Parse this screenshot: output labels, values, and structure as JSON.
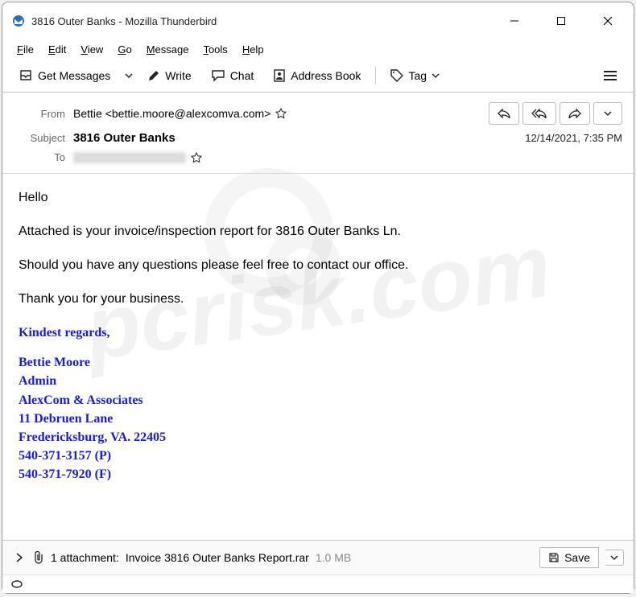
{
  "window": {
    "title": "3816 Outer Banks - Mozilla Thunderbird"
  },
  "menus": {
    "file": "File",
    "edit": "Edit",
    "view": "View",
    "go": "Go",
    "message": "Message",
    "tools": "Tools",
    "help": "Help"
  },
  "toolbar": {
    "get": "Get Messages",
    "write": "Write",
    "chat": "Chat",
    "address": "Address Book",
    "tag": "Tag"
  },
  "headers": {
    "from_label": "From",
    "from_value": "Bettie <bettie.moore@alexcomva.com>",
    "subject_label": "Subject",
    "subject_value": "3816 Outer Banks",
    "datetime": "12/14/2021, 7:35 PM",
    "to_label": "To"
  },
  "body": {
    "greeting": "Hello",
    "p1": "Attached is your invoice/inspection report for 3816 Outer Banks Ln.",
    "p2": "Should you have any questions please feel free to contact our office.",
    "p3": "Thank you for your business.",
    "sig": {
      "regards": "Kindest regards,",
      "name": "Bettie Moore",
      "role": "Admin",
      "company": "AlexCom & Associates",
      "addr1": "11 Debruen Lane",
      "addr2": "Fredericksburg, VA. 22405",
      "phone_p": "540-371-3157 (P)",
      "phone_f": "540-371-7920 (F)"
    }
  },
  "attachment": {
    "count_label": "1 attachment:",
    "filename": "Invoice 3816 Outer Banks Report.rar",
    "size": "1.0 MB",
    "save": "Save"
  },
  "watermark": "pcrisk.com"
}
